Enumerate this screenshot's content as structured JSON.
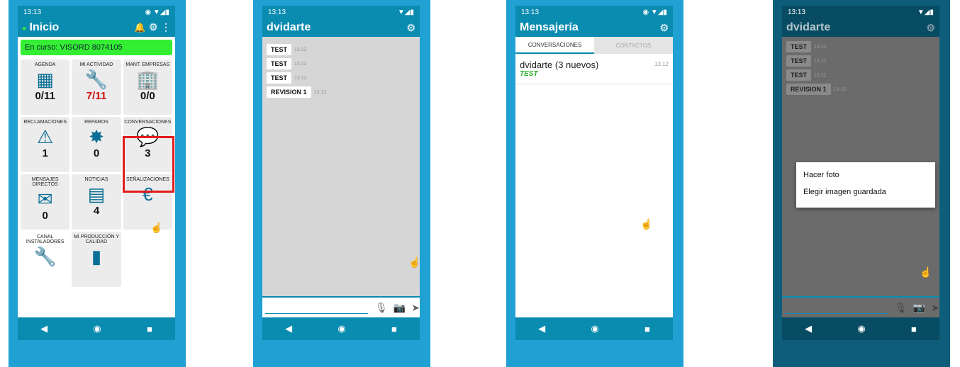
{
  "phone1": {
    "status_time": "13:13",
    "title": "Inicio",
    "banner": "En curso: VISORD 8074105",
    "tiles": [
      {
        "label": "AGENDA",
        "icon": "calendar-icon",
        "glyph": "▦",
        "value": "0/11"
      },
      {
        "label": "MI ACTIVIDAD",
        "icon": "wrench-icon",
        "glyph": "🔧",
        "value": "7/11",
        "value_color": "red"
      },
      {
        "label": "MANT. EMPRESAS",
        "icon": "building-wrench-icon",
        "glyph": "🏢",
        "value": "0/0"
      },
      {
        "label": "RECLAMACIONES",
        "icon": "warning-icon",
        "glyph": "⚠",
        "value": "1"
      },
      {
        "label": "REPAROS",
        "icon": "badge-r-icon",
        "glyph": "✸",
        "value": "0"
      },
      {
        "label": "CONVERSACIONES",
        "icon": "chat-wrench-icon",
        "glyph": "💬",
        "value": "3"
      },
      {
        "label": "MENSAJES DIRECTOS",
        "icon": "mail-icon",
        "glyph": "✉",
        "value": "0"
      },
      {
        "label": "NOTICIAS",
        "icon": "news-icon",
        "glyph": "▤",
        "value": "4"
      },
      {
        "label": "SEÑALIZACIONES",
        "icon": "euro-icon",
        "glyph": "€",
        "value": ""
      },
      {
        "label": "CANAL INSTALADORES",
        "icon": "channel-icon",
        "glyph": "🔧",
        "value": ""
      },
      {
        "label": "MI PRODUCCIÓN Y CALIDAD",
        "icon": "bar-chart-icon",
        "glyph": "▮",
        "value": ""
      }
    ]
  },
  "phone2": {
    "status_time": "13:13",
    "title": "dvidarte",
    "messages": [
      {
        "text": "TEST",
        "time": "13:12"
      },
      {
        "text": "TEST",
        "time": "13:12"
      },
      {
        "text": "TEST",
        "time": "13:12"
      },
      {
        "text": "REVISION 1",
        "time": "13:13"
      }
    ]
  },
  "phone3": {
    "status_time": "13:13",
    "title": "Mensajería",
    "tabs": [
      "CONVERSACIONES",
      "CONTACTOS"
    ],
    "conversation": {
      "name": "dvidarte (3 nuevos)",
      "time": "13:12",
      "preview": "TEST"
    }
  },
  "phone4": {
    "status_time": "13:13",
    "title": "dvidarte",
    "messages": [
      {
        "text": "TEST",
        "time": "13:12"
      },
      {
        "text": "TEST",
        "time": "13:12"
      },
      {
        "text": "TEST",
        "time": "13:12"
      },
      {
        "text": "REVISION 1",
        "time": "13:13"
      }
    ],
    "dialog_options": [
      "Hacer foto",
      "Elegir imagen guardada"
    ]
  },
  "nav": {
    "back": "◀",
    "home": "◉",
    "recents": "■"
  }
}
